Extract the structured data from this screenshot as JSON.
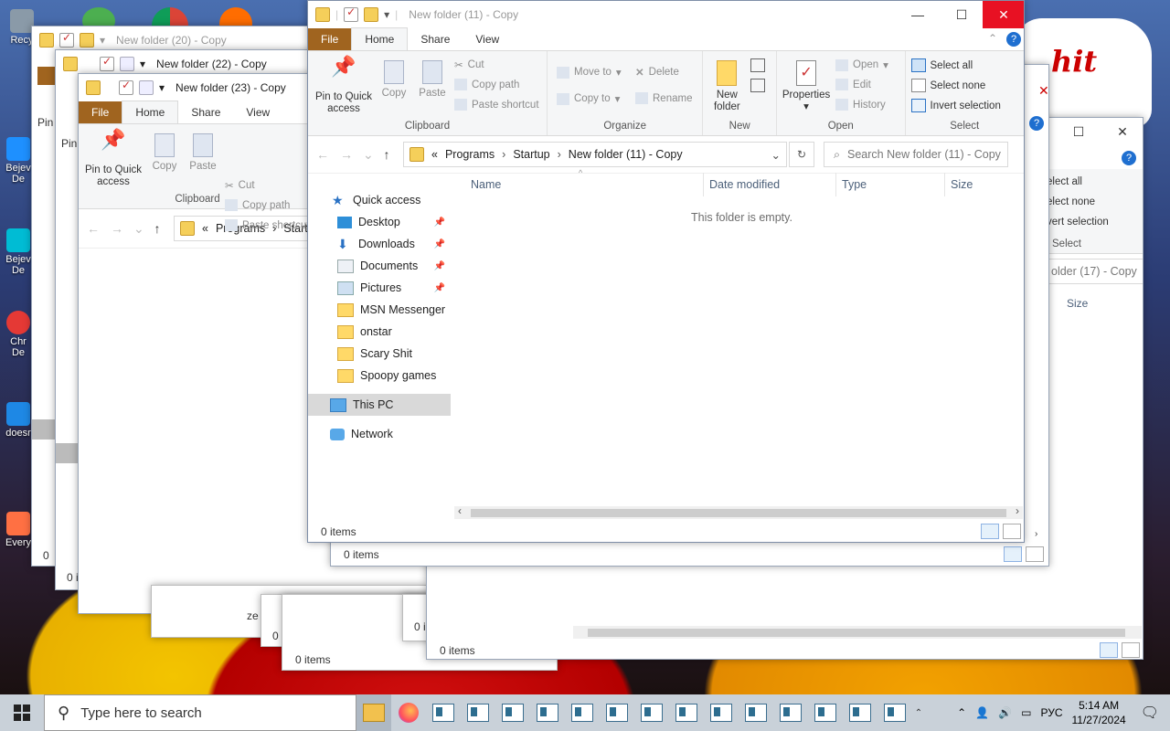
{
  "desktop": {
    "icons": [
      {
        "label": "Recy",
        "color": "#8a9aa8"
      },
      {
        "label": "Bejev\nDe",
        "color": "#1e90ff"
      },
      {
        "label": "Bejev\nDe",
        "color": "#00bcd4"
      },
      {
        "label": "Chr\nDe",
        "color": "#e53935"
      },
      {
        "label": "doesr",
        "color": "#1e88e5"
      },
      {
        "label": "Every",
        "color": "#ff7043"
      }
    ],
    "speech_text": "hit"
  },
  "windows": {
    "w20": {
      "title": "New folder (20) - Copy"
    },
    "w22": {
      "title": "New folder (22) - Copy"
    },
    "w23": {
      "title": "New folder (23) - Copy",
      "tabs": [
        "File",
        "Home",
        "Share",
        "View"
      ],
      "clipboard": {
        "pin": "Pin to Quick\naccess",
        "copy": "Copy",
        "paste": "Paste",
        "cut": "Cut",
        "copy_path": "Copy path",
        "paste_shortcut": "Paste shortcut",
        "label": "Clipboard"
      },
      "path": [
        "«",
        "Programs",
        "Startu"
      ]
    },
    "right_bg": {
      "select_all": "elect all",
      "select_none": "elect none",
      "invert": "vert selection",
      "select_label": "Select",
      "search": "older (17) - Copy",
      "size": "Size"
    },
    "main": {
      "title": "New folder (11) - Copy",
      "tabs": [
        "File",
        "Home",
        "Share",
        "View"
      ],
      "clipboard": {
        "pin": "Pin to Quick\naccess",
        "copy": "Copy",
        "paste": "Paste",
        "cut": "Cut",
        "copy_path": "Copy path",
        "paste_shortcut": "Paste shortcut",
        "label": "Clipboard"
      },
      "organize": {
        "move_to": "Move to",
        "copy_to": "Copy to",
        "delete": "Delete",
        "rename": "Rename",
        "label": "Organize"
      },
      "new": {
        "new_folder": "New\nfolder",
        "label": "New"
      },
      "open": {
        "properties": "Properties",
        "open": "Open",
        "edit": "Edit",
        "history": "History",
        "label": "Open"
      },
      "select": {
        "select_all": "Select all",
        "select_none": "Select none",
        "invert": "Invert selection",
        "label": "Select"
      },
      "path": [
        "«",
        "Programs",
        "›",
        "Startup",
        "›",
        "New folder (11) - Copy"
      ],
      "search_placeholder": "Search New folder (11) - Copy",
      "nav": {
        "quick_access": "Quick access",
        "items": [
          {
            "label": "Desktop",
            "pinned": "📌"
          },
          {
            "label": "Downloads",
            "pinned": "📌"
          },
          {
            "label": "Documents",
            "pinned": "📌"
          },
          {
            "label": "Pictures",
            "pinned": "📌"
          },
          {
            "label": "MSN Messenger"
          },
          {
            "label": "onstar"
          },
          {
            "label": "Scary Shit"
          },
          {
            "label": "Spoopy games"
          }
        ],
        "this_pc": "This PC",
        "network": "Network"
      },
      "columns": [
        "Name",
        "Date modified",
        "Type",
        "Size"
      ],
      "empty_text": "This folder is empty.",
      "status": "0 items"
    },
    "under_main_status": "0 items",
    "bottom_status": "0 items",
    "bottom_right_status": "0 items",
    "left_status_1": "0 i",
    "left_status_2": "0 i",
    "left_status_3": "0",
    "mid_status_1": "0 i",
    "mid_status_2": "0 i",
    "mid_fragment": "ze"
  },
  "taskbar": {
    "search_placeholder": "Type here to search",
    "lang": "РУС",
    "time": "5:14 AM",
    "date": "11/27/2024",
    "explorer_count": 14
  }
}
